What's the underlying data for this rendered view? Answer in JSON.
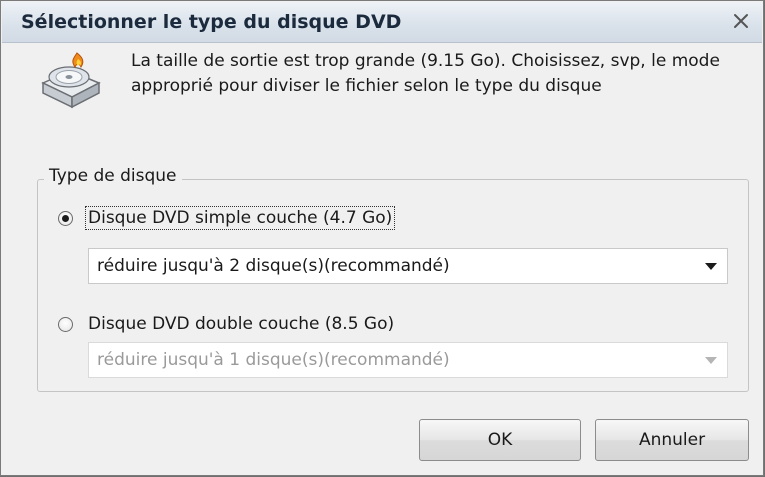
{
  "window": {
    "title": "Sélectionner le type du disque DVD",
    "close_icon": "close-icon"
  },
  "message": "La taille de sortie est trop grande (9.15 Go). Choisissez, svp, le mode approprié pour diviser le fichier selon le type du disque",
  "disk_icon": "dvd-burner-icon",
  "group": {
    "legend": "Type de disque",
    "options": [
      {
        "label": "Disque DVD simple couche (4.7 Go)",
        "checked": true,
        "select_value": "réduire jusqu'à 2 disque(s)(recommandé)",
        "select_enabled": true
      },
      {
        "label": "Disque DVD double couche (8.5 Go)",
        "checked": false,
        "select_value": "réduire jusqu'à 1 disque(s)(recommandé)",
        "select_enabled": false
      }
    ]
  },
  "buttons": {
    "ok": "OK",
    "cancel": "Annuler"
  },
  "colors": {
    "title_text": "#1b2a3d",
    "dialog_bg": "#f0f0f0",
    "disabled_text": "#9a9a9a"
  }
}
